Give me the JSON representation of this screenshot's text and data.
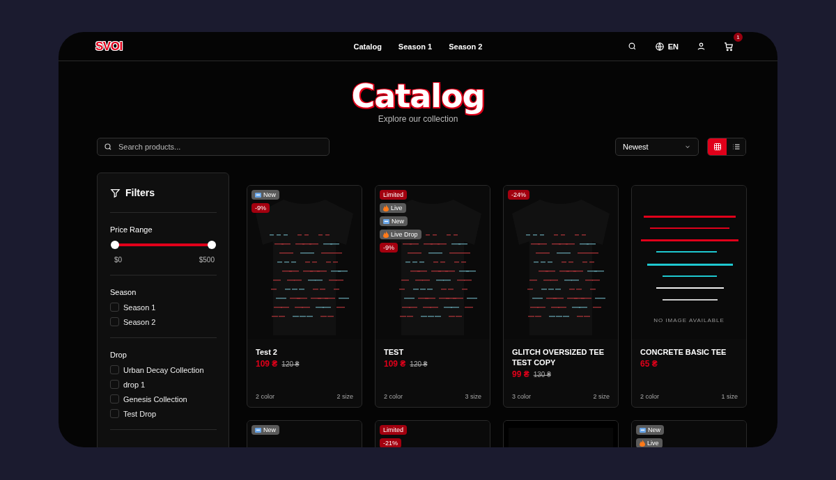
{
  "header": {
    "logo": "SVOI",
    "nav": [
      {
        "label": "Catalog"
      },
      {
        "label": "Season 1"
      },
      {
        "label": "Season 2"
      }
    ],
    "language": "EN",
    "cart_count": "1"
  },
  "hero": {
    "title": "Catalog",
    "subtitle": "Explore our collection"
  },
  "toolbar": {
    "search": {
      "placeholder": "Search products..."
    },
    "sort": "Newest",
    "views": [
      {
        "kind": "grid",
        "selected": true
      },
      {
        "kind": "list",
        "selected": false
      }
    ]
  },
  "filters": {
    "title": "Filters",
    "price": {
      "label": "Price Range",
      "thumbs": [
        {
          "level": 0
        },
        {
          "level": 1
        }
      ],
      "min": "$0",
      "max": "$500"
    },
    "groups": [
      {
        "title": "Season",
        "options": [
          {
            "label": "Season 1",
            "checked": false
          },
          {
            "label": "Season 2",
            "checked": false
          }
        ]
      },
      {
        "title": "Drop",
        "options": [
          {
            "label": "Urban Decay Collection",
            "checked": false
          },
          {
            "label": "drop 1",
            "checked": false
          },
          {
            "label": "Genesis Collection",
            "checked": false
          },
          {
            "label": "Test Drop",
            "checked": false
          }
        ]
      }
    ]
  },
  "products": [
    {
      "kind": "shirt",
      "badges": [
        {
          "kind": "new",
          "label": "New"
        },
        {
          "kind": "discount",
          "label": "-9%"
        }
      ],
      "name": "Test 2",
      "price": "109 ₴",
      "old_price": "120 ₴",
      "colors": "2 color",
      "sizes": "2 size"
    },
    {
      "kind": "shirt",
      "badges": [
        {
          "kind": "limited",
          "label": "Limited"
        },
        {
          "kind": "live",
          "label": "Live"
        },
        {
          "kind": "new",
          "label": "New"
        },
        {
          "kind": "live",
          "label": "Live Drop"
        },
        {
          "kind": "discount",
          "label": "-9%"
        }
      ],
      "name": "TEST",
      "price": "109 ₴",
      "old_price": "120 ₴",
      "colors": "2 color",
      "sizes": "3 size"
    },
    {
      "kind": "shirt",
      "badges": [
        {
          "kind": "discount",
          "label": "-24%"
        }
      ],
      "name": "GLITCH OVERSIZED TEE TEST COPY",
      "price": "99 ₴",
      "old_price": "130 ₴",
      "colors": "3 color",
      "sizes": "2 size"
    },
    {
      "kind": "none",
      "no_image_text": "NO IMAGE AVAILABLE",
      "name": "CONCRETE BASIC TEE",
      "price": "65 ₴",
      "colors": "2 color",
      "sizes": "1 size"
    },
    {
      "kind": "shirt",
      "badges": [
        {
          "kind": "new",
          "label": "New"
        }
      ]
    },
    {
      "kind": "shirt",
      "badges": [
        {
          "kind": "limited",
          "label": "Limited"
        },
        {
          "kind": "discount",
          "label": "-21%"
        }
      ]
    },
    {
      "kind": "dark"
    },
    {
      "kind": "shirt",
      "badges": [
        {
          "kind": "new",
          "label": "New"
        },
        {
          "kind": "live",
          "label": "Live"
        }
      ]
    }
  ]
}
